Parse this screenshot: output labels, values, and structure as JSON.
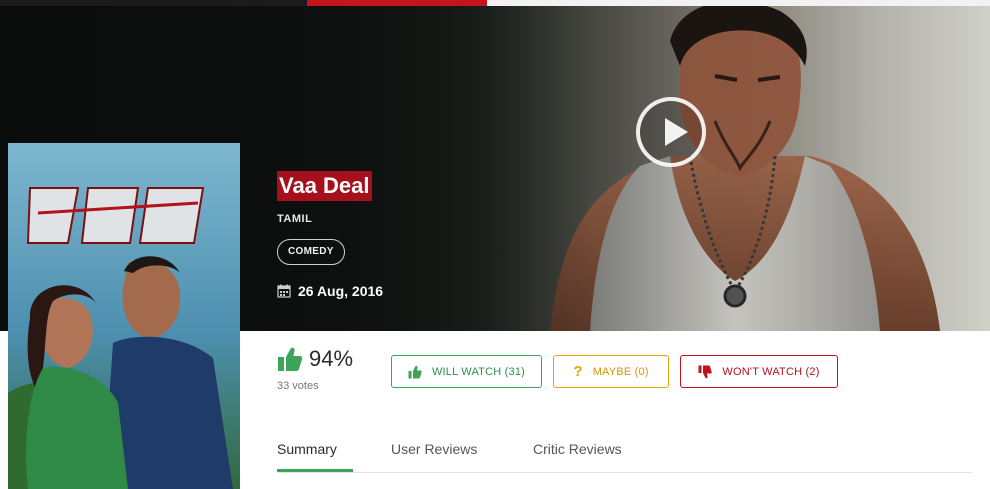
{
  "movie": {
    "title": "Vaa Deal",
    "language": "TAMIL",
    "genre": "COMEDY",
    "release_date": "26 Aug, 2016"
  },
  "rating": {
    "percent": "94%",
    "votes": "33 votes"
  },
  "vote_buttons": {
    "will_watch": "WILL WATCH (31)",
    "maybe_icon": "?",
    "maybe": "MAYBE (0)",
    "wont_watch": "WON'T WATCH (2)"
  },
  "tabs": [
    "Summary",
    "User Reviews",
    "Critic Reviews"
  ],
  "icons": {
    "play": "play-icon",
    "calendar": "calendar-icon",
    "thumbs_up": "thumbs-up-icon",
    "thumbs_down": "thumbs-down-icon",
    "question": "question-icon"
  },
  "colors": {
    "accent_red": "#c4141c",
    "title_highlight": "#a5101a",
    "green": "#3da45c",
    "amber": "#e8a300"
  }
}
